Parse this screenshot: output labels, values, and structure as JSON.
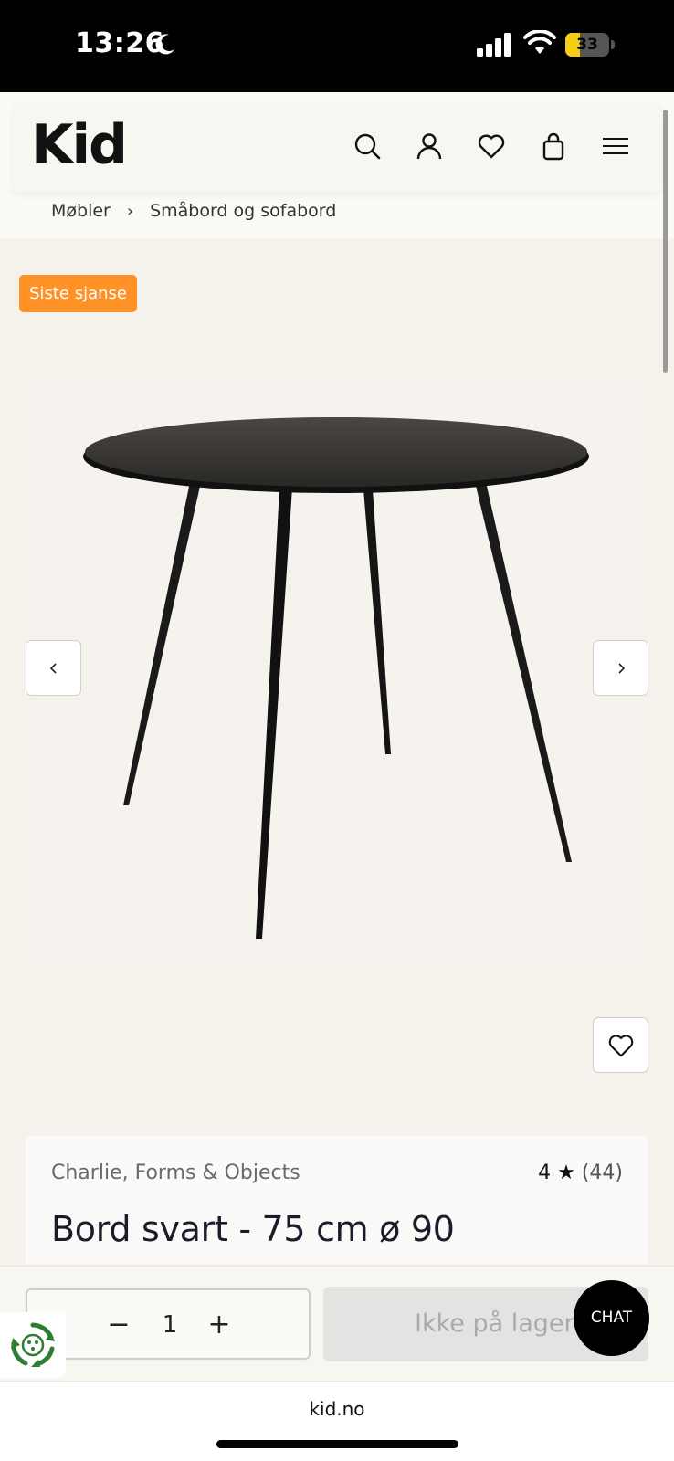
{
  "status_bar": {
    "time": "13:26",
    "battery": "33",
    "battery_level": 0.33
  },
  "header": {
    "logo": "Kid",
    "icons": [
      "search-icon",
      "user-icon",
      "heart-icon",
      "bag-icon",
      "menu-icon"
    ]
  },
  "breadcrumb": {
    "items": [
      "Møbler",
      "Småbord og sofabord"
    ],
    "separator": "›"
  },
  "product": {
    "badge": "Siste sjanse",
    "brand": "Charlie, Forms & Objects",
    "rating_value": "4 ★",
    "rating_count": "(44)",
    "title": "Bord svart - 75 cm ø 90"
  },
  "purchase": {
    "minus": "−",
    "quantity": "1",
    "plus": "+",
    "stock_label": "Ikke på lager"
  },
  "chat": {
    "label": "CHAT"
  },
  "browser": {
    "url": "kid.no"
  },
  "colors": {
    "badge": "#ff9227",
    "background": "#f5f2ec",
    "chat": "#000000"
  }
}
